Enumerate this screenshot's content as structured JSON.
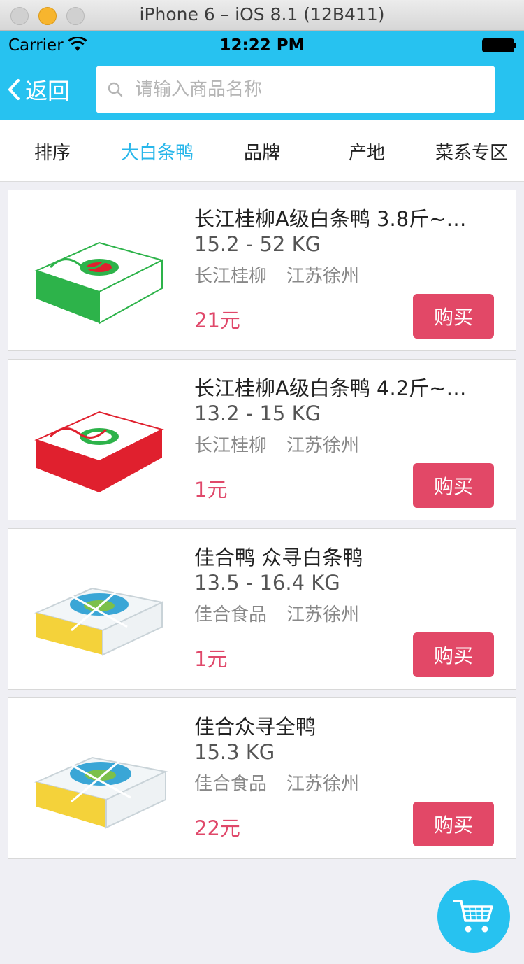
{
  "window": {
    "title": "iPhone 6 – iOS 8.1 (12B411)"
  },
  "status_bar": {
    "carrier": "Carrier",
    "time": "12:22 PM"
  },
  "nav": {
    "back_label": "返回",
    "search_placeholder": "请输入商品名称",
    "search_value": ""
  },
  "filters": [
    {
      "label": "排序",
      "active": false
    },
    {
      "label": "大白条鸭",
      "active": true
    },
    {
      "label": "品牌",
      "active": false
    },
    {
      "label": "产地",
      "active": false
    },
    {
      "label": "菜系专区",
      "active": false
    }
  ],
  "products": [
    {
      "title": "长江桂柳A级白条鸭 3.8斤~…",
      "weight": "15.2 - 52 KG",
      "brand": "长江桂柳",
      "origin": "江苏徐州",
      "price": "21元",
      "buy_label": "购买",
      "box_color": "#2db34a"
    },
    {
      "title": "长江桂柳A级白条鸭 4.2斤~…",
      "weight": "13.2 - 15 KG",
      "brand": "长江桂柳",
      "origin": "江苏徐州",
      "price": "1元",
      "buy_label": "购买",
      "box_color": "#e0202e"
    },
    {
      "title": "佳合鸭 众寻白条鸭",
      "weight": "13.5 - 16.4 KG",
      "brand": "佳合食品",
      "origin": "江苏徐州",
      "price": "1元",
      "buy_label": "购买",
      "box_color": "#f4d23a"
    },
    {
      "title": "佳合众寻全鸭",
      "weight": "15.3 KG",
      "brand": "佳合食品",
      "origin": "江苏徐州",
      "price": "22元",
      "buy_label": "购买",
      "box_color": "#f4d23a"
    }
  ],
  "colors": {
    "accent": "#27c2f0",
    "buy": "#e24867",
    "price": "#e0486a"
  },
  "icons": {
    "back": "chevron-left-icon",
    "search": "search-icon",
    "cart": "shopping-cart-icon",
    "wifi": "wifi-icon",
    "battery": "battery-icon"
  }
}
